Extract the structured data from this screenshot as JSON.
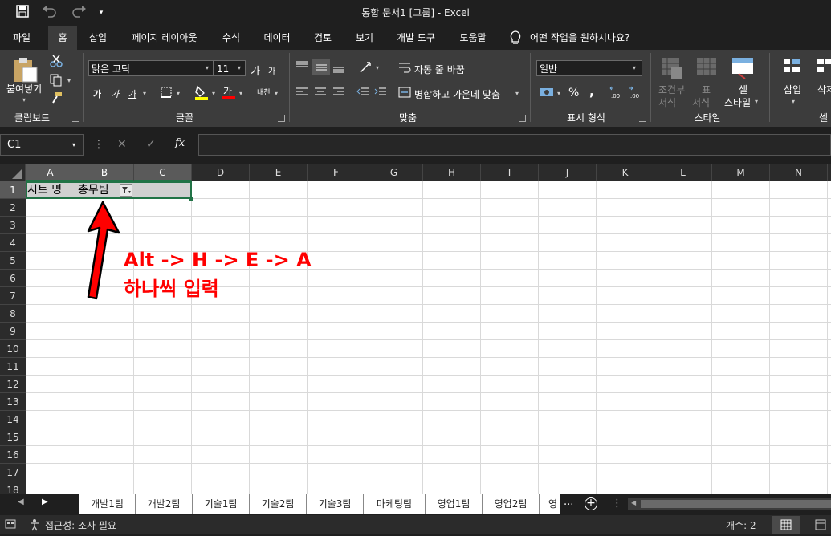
{
  "window": {
    "title": "통합 문서1  [그룹]  -  Excel"
  },
  "quick_access": {
    "save_icon": "save-icon",
    "undo_icon": "undo-icon",
    "redo_icon": "redo-icon",
    "customize_icon": "customize-icon"
  },
  "tabs": [
    {
      "label": "파일"
    },
    {
      "label": "홈"
    },
    {
      "label": "삽입"
    },
    {
      "label": "페이지 레이아웃"
    },
    {
      "label": "수식"
    },
    {
      "label": "데이터"
    },
    {
      "label": "검토"
    },
    {
      "label": "보기"
    },
    {
      "label": "개발 도구"
    },
    {
      "label": "도움말"
    }
  ],
  "tell_me": {
    "placeholder": "어떤 작업을 원하시나요?",
    "icon": "lightbulb-icon"
  },
  "ribbon": {
    "clipboard": {
      "paste_label": "붙여넣기",
      "group_label": "클립보드"
    },
    "font": {
      "font_name": "맑은 고딕",
      "font_size": "11",
      "grow": "가",
      "shrink": "가",
      "bold": "가",
      "italic": "가",
      "underline": "가",
      "font_color_letter": "가",
      "phonetic": "내천",
      "group_label": "글꼴"
    },
    "alignment": {
      "wrap_text": "자동 줄 바꿈",
      "merge_center": "병합하고 가운데 맞춤",
      "group_label": "맞춤"
    },
    "number": {
      "format": "일반",
      "percent": "%",
      "comma": ",",
      "group_label": "표시 형식"
    },
    "styles": {
      "conditional": "조건부\n서식",
      "conditional_line1": "조건부",
      "conditional_line2": "서식",
      "table_line1": "표",
      "table_line2": "서식",
      "cell_line1": "셀",
      "cell_line2": "스타일",
      "group_label": "스타일"
    },
    "cells": {
      "insert": "삽입",
      "delete_partial": "삭제",
      "group_label_partial": "셀"
    }
  },
  "formula_bar": {
    "name_box": "C1",
    "cancel": "✕",
    "enter": "✓",
    "fx": "fx",
    "value": ""
  },
  "grid": {
    "columns": [
      "A",
      "B",
      "C",
      "D",
      "E",
      "F",
      "G",
      "H",
      "I",
      "J",
      "K",
      "L",
      "M",
      "N"
    ],
    "rows": [
      "1",
      "2",
      "3",
      "4",
      "5",
      "6",
      "7",
      "8",
      "9",
      "10",
      "11",
      "12",
      "13",
      "14",
      "15",
      "16",
      "17",
      "18"
    ],
    "cell_a1": "시트 명",
    "cell_b1": "총무팀"
  },
  "annotation": {
    "line1": "Alt -> H -> E -> A",
    "line2": "하나씩 입력",
    "color": "#ff0000"
  },
  "sheets": [
    {
      "label": "개발1팀"
    },
    {
      "label": "개발2팀"
    },
    {
      "label": "기술1팀"
    },
    {
      "label": "기술2팀"
    },
    {
      "label": "기술3팀"
    },
    {
      "label": "마케팅팀"
    },
    {
      "label": "영업1팀"
    },
    {
      "label": "영업2팀"
    },
    {
      "label": "영"
    }
  ],
  "sheet_nav": {
    "more": "...",
    "add": "+"
  },
  "status": {
    "accessibility": "접근성: 조사 필요",
    "count": "개수: 2"
  },
  "colors": {
    "accent": "#217346",
    "ribbon": "#3c3c3c",
    "dark": "#1f1f1f"
  }
}
